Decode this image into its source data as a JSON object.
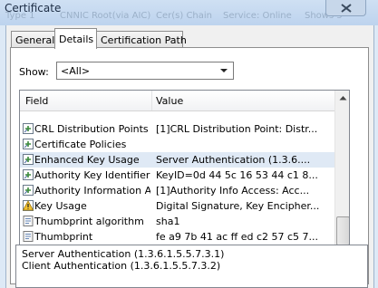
{
  "window": {
    "title": "Certificate"
  },
  "background_text": [
    "Type 1",
    "CNNIC Root(via AIC)",
    "Cer(s) Chain",
    "Service: Online",
    "Shows 5"
  ],
  "tabs": [
    {
      "label": "General",
      "active": false
    },
    {
      "label": "Details",
      "active": true
    },
    {
      "label": "Certification Path",
      "active": false
    }
  ],
  "show": {
    "label": "Show:",
    "selected": "<All>"
  },
  "list": {
    "columns": {
      "field": "Field",
      "value": "Value"
    },
    "rows": [
      {
        "field": "CRL Distribution Points",
        "value": "[1]CRL Distribution Point: Distr...",
        "icon": "extension-icon",
        "selected": false
      },
      {
        "field": "Certificate Policies",
        "value": "",
        "icon": "extension-icon",
        "selected": false
      },
      {
        "field": "Enhanced Key Usage",
        "value": "Server Authentication (1.3.6....",
        "icon": "extension-icon",
        "selected": true
      },
      {
        "field": "Authority Key Identifier",
        "value": "KeyID=0d 44 5c 16 53 44 c1 8...",
        "icon": "extension-icon",
        "selected": false
      },
      {
        "field": "Authority Information A...",
        "value": "[1]Authority Info Access: Acc...",
        "icon": "extension-icon",
        "selected": false
      },
      {
        "field": "Key Usage",
        "value": "Digital Signature, Key Encipher...",
        "icon": "critical-extension-icon",
        "selected": false
      },
      {
        "field": "Thumbprint algorithm",
        "value": "sha1",
        "icon": "property-icon",
        "selected": false
      },
      {
        "field": "Thumbprint",
        "value": "fe a9 7b 41 ac ff ed c2 57 c5 7...",
        "icon": "property-icon",
        "selected": false
      }
    ]
  },
  "detail": {
    "lines": [
      "Server Authentication (1.3.6.1.5.5.7.3.1)",
      "Client Authentication (1.3.6.1.5.5.7.3.2)"
    ]
  },
  "colors": {
    "selected_row": "#dfe9f5",
    "titlebar": "#bdd3ee",
    "dialog_bg": "#f0f0f0"
  }
}
